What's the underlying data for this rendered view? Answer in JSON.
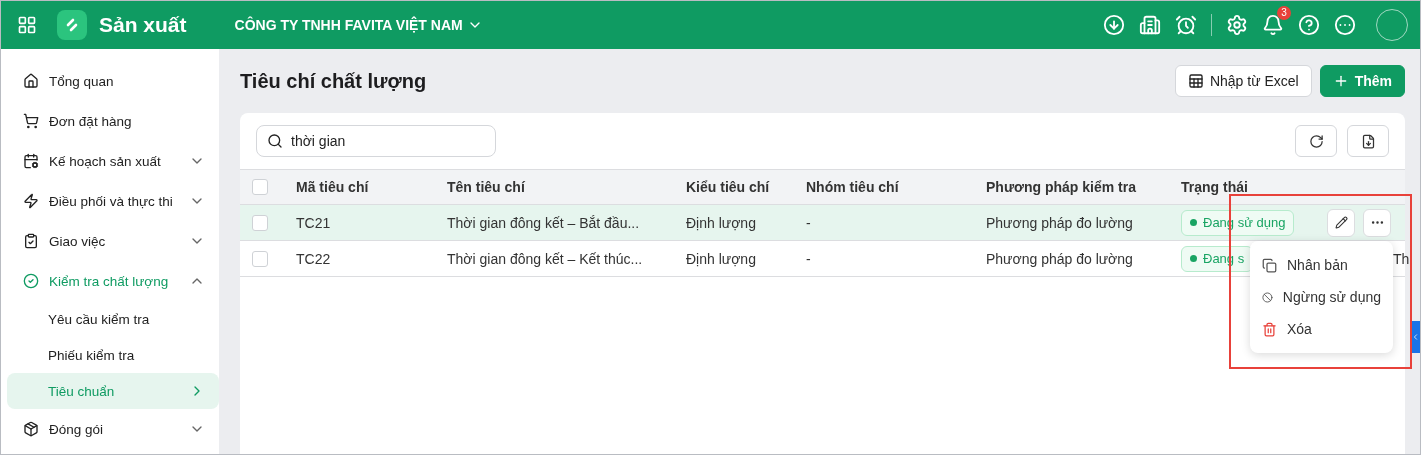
{
  "app": {
    "name": "Sản xuất",
    "company": "CÔNG TY TNHH FAVITA VIỆT NAM",
    "notification_count": "3"
  },
  "sidebar": {
    "items": [
      {
        "label": "Tổng quan",
        "selected": false
      },
      {
        "label": "Đơn đặt hàng",
        "selected": false
      },
      {
        "label": "Kế hoạch sản xuất",
        "expanded": false,
        "selected": false
      },
      {
        "label": "Điều phối và thực thi",
        "expanded": false,
        "selected": false
      },
      {
        "label": "Giao việc",
        "expanded": false,
        "selected": false
      },
      {
        "label": "Kiểm tra chất lượng",
        "expanded": true,
        "selected": true,
        "children": [
          {
            "label": "Yêu cầu kiểm tra",
            "selected": false
          },
          {
            "label": "Phiếu kiểm tra",
            "selected": false
          },
          {
            "label": "Tiêu chuẩn",
            "selected": true
          }
        ]
      },
      {
        "label": "Đóng gói",
        "expanded": false,
        "selected": false
      }
    ]
  },
  "page": {
    "title": "Tiêu chí chất lượng",
    "buttons": [
      {
        "label": "Nhập từ Excel",
        "kind": "secondary"
      },
      {
        "label": "Thêm",
        "kind": "primary"
      }
    ]
  },
  "search": {
    "value": "thời gian"
  },
  "table": {
    "columns": [
      "Mã tiêu chí",
      "Tên tiêu chí",
      "Kiểu tiêu chí",
      "Nhóm tiêu chí",
      "Phương pháp kiểm tra",
      "Trạng thái"
    ],
    "all_checked": false,
    "rows": [
      {
        "selected": true,
        "checked": false,
        "cells": [
          "TC21",
          "Thời gian đông kết – Bắt đầu...",
          "Định lượng",
          "-",
          "Phương pháp đo lường"
        ],
        "status": "Đang sử dụng",
        "actions_visible": true
      },
      {
        "selected": false,
        "checked": false,
        "cells": [
          "TC22",
          "Thời gian đông kết – Kết thúc...",
          "Định lượng",
          "-",
          "Phương pháp đo lường"
        ],
        "status": "Đang s",
        "column_7": "Th"
      }
    ]
  },
  "context_menu": {
    "items": [
      {
        "label": "Nhân bản",
        "kind": "copy"
      },
      {
        "label": "Ngừng sử dụng",
        "kind": "disable"
      },
      {
        "label": "Xóa",
        "kind": "delete"
      }
    ]
  }
}
